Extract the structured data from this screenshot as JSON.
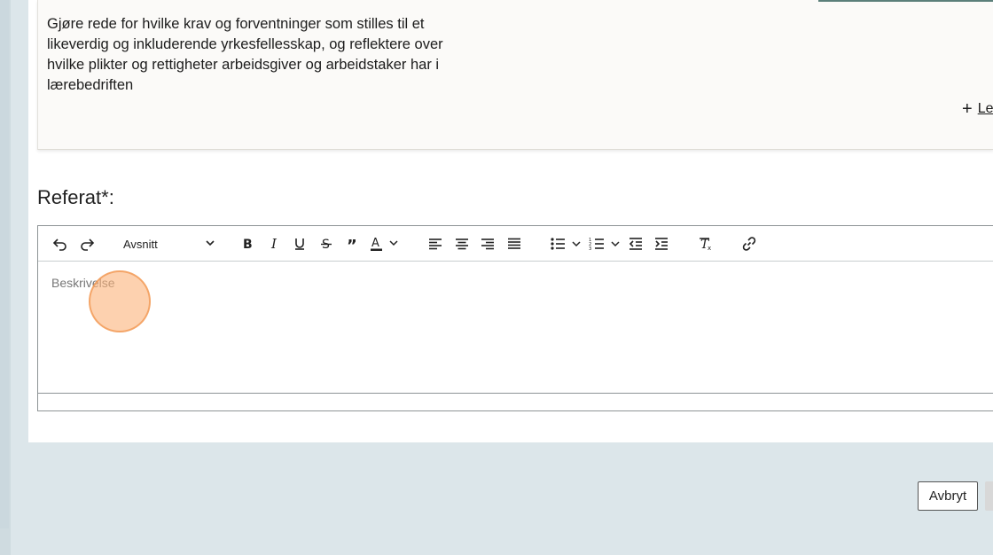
{
  "goal": {
    "text": "Gjøre rede for hvilke krav og forventninger som stilles til et likeverdig og inkluderende yrkesfellesskap, og reflektere over hvilke plikter og rettigheter arbeidsgiver og arbeidstaker har i lærebedriften",
    "read_more_label": "Le"
  },
  "referat": {
    "label": "Referat*:",
    "placeholder": "Beskrivelse",
    "block_format": "Avsnitt"
  },
  "toolbar": {
    "icons": [
      "undo-icon",
      "redo-icon",
      "bold-icon",
      "italic-icon",
      "underline-icon",
      "strikethrough-icon",
      "blockquote-icon",
      "text-color-icon",
      "align-left-icon",
      "align-center-icon",
      "align-right-icon",
      "align-justify-icon",
      "bullet-list-icon",
      "numbered-list-icon",
      "outdent-icon",
      "indent-icon",
      "clear-formatting-icon",
      "link-icon"
    ]
  },
  "actions": {
    "cancel_label": "Avbryt"
  }
}
